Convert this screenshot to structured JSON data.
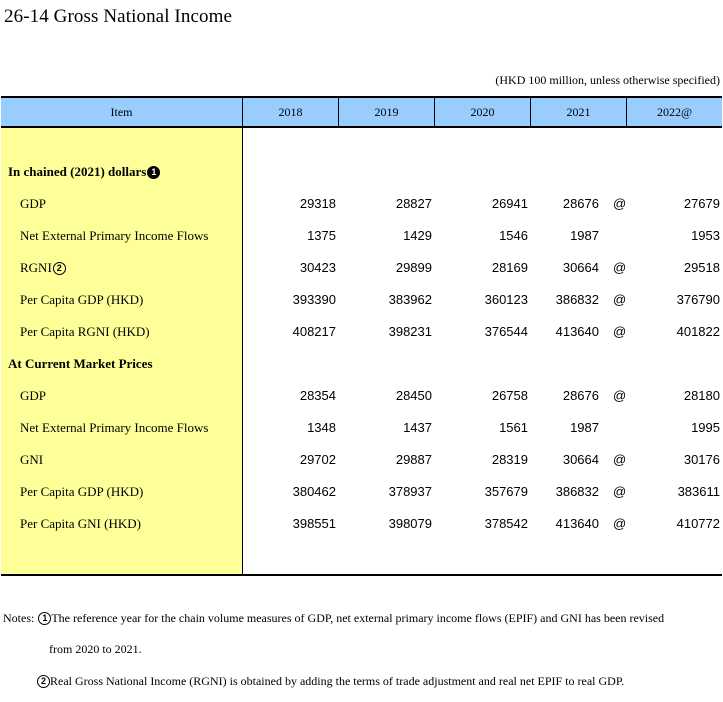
{
  "title": "26-14  Gross National Income",
  "unit_note": "(HKD 100 million, unless otherwise specified)",
  "header": {
    "item": "Item",
    "years": [
      "2018",
      "2019",
      "2020",
      "2021",
      "2022@"
    ]
  },
  "sections": [
    {
      "label": "In chained (2021) dollars",
      "marker": "1",
      "rows": [
        {
          "label": "GDP",
          "marker": "",
          "values": [
            "29318",
            "28827",
            "26941",
            "28676",
            "27679"
          ],
          "flag2021": "@"
        },
        {
          "label": "Net External Primary Income Flows",
          "marker": "",
          "values": [
            "1375",
            "1429",
            "1546",
            "1987",
            "1953"
          ],
          "flag2021": ""
        },
        {
          "label": "RGNI",
          "marker": "2",
          "values": [
            "30423",
            "29899",
            "28169",
            "30664",
            "29518"
          ],
          "flag2021": "@"
        },
        {
          "label": "Per Capita GDP (HKD)",
          "marker": "",
          "values": [
            "393390",
            "383962",
            "360123",
            "386832",
            "376790"
          ],
          "flag2021": "@"
        },
        {
          "label": "Per Capita RGNI (HKD)",
          "marker": "",
          "values": [
            "408217",
            "398231",
            "376544",
            "413640",
            "401822"
          ],
          "flag2021": "@"
        }
      ]
    },
    {
      "label": "At Current Market Prices",
      "marker": "",
      "rows": [
        {
          "label": "GDP",
          "marker": "",
          "values": [
            "28354",
            "28450",
            "26758",
            "28676",
            "28180"
          ],
          "flag2021": "@"
        },
        {
          "label": "Net External Primary Income Flows",
          "marker": "",
          "values": [
            "1348",
            "1437",
            "1561",
            "1987",
            "1995"
          ],
          "flag2021": ""
        },
        {
          "label": "GNI",
          "marker": "",
          "values": [
            "29702",
            "29887",
            "28319",
            "30664",
            "30176"
          ],
          "flag2021": "@"
        },
        {
          "label": "Per Capita GDP (HKD)",
          "marker": "",
          "values": [
            "380462",
            "378937",
            "357679",
            "386832",
            "383611"
          ],
          "flag2021": "@"
        },
        {
          "label": "Per Capita GNI (HKD)",
          "marker": "",
          "values": [
            "398551",
            "398079",
            "378542",
            "413640",
            "410772"
          ],
          "flag2021": "@"
        }
      ]
    }
  ],
  "notes": {
    "prefix": "Notes:",
    "note1_marker": "1",
    "note1_line1": "The reference year for the chain volume measures of GDP, net external primary income flows (EPIF) and GNI has been revised",
    "note1_line2": "from 2020 to 2021.",
    "note2_marker": "2",
    "note2_line1": "Real Gross National Income (RGNI) is obtained by adding the terms of trade adjustment and real net EPIF to real GDP."
  },
  "colors": {
    "header_bg": "#99ccff",
    "item_col_bg": "#ffff99"
  }
}
